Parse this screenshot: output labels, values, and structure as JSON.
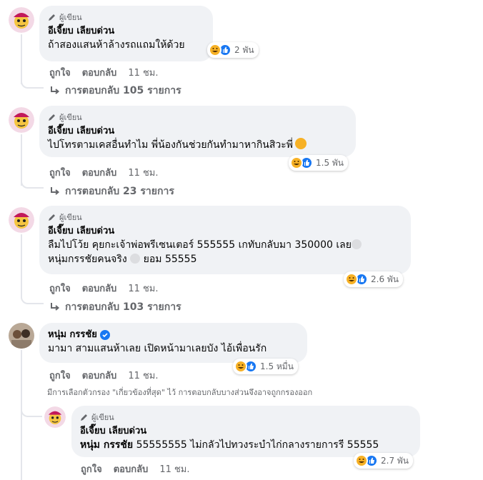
{
  "badge_label": "ผู้เขียน",
  "comments": [
    {
      "name": "อีเจี๊ยบ เลียบด่วน",
      "text": "ถ้าสองแสนห้าล้างรถแถมให้ด้วย",
      "reaction_count": "2 พัน",
      "like_label": "ถูกใจ",
      "reply_label": "ตอบกลับ",
      "time": "11 ชม.",
      "view_replies": "การตอบกลับ 105 รายการ"
    },
    {
      "name": "อีเจี๊ยบ เลียบด่วน",
      "text": "ไปโทรตามเคสอื่นทำไม พี่น้องกันช่วยกันทำมาหากินสิวะพี่",
      "reaction_count": "1.5 พัน",
      "like_label": "ถูกใจ",
      "reply_label": "ตอบกลับ",
      "time": "11 ชม.",
      "view_replies": "การตอบกลับ 23 รายการ"
    },
    {
      "name": "อีเจี๊ยบ เลียบด่วน",
      "text_line1": "ลืมไปโว้ย คุยกะเจ้าพ่อพรีเซนเตอร์ 555555 เกทับกลับมา 350000 เลย",
      "text_line2a": "หนุ่มกรรชัยคนจริง",
      "text_line2b": "ยอม 55555",
      "reaction_count": "2.6 พัน",
      "like_label": "ถูกใจ",
      "reply_label": "ตอบกลับ",
      "time": "11 ชม.",
      "view_replies": "การตอบกลับ 103 รายการ"
    },
    {
      "name": "หนุ่ม กรรชัย",
      "text": "มามา สามแสนห้าเลย เปิดหน้ามาเลยบัง ไอ้เพื่อนรัก",
      "reaction_count": "1.5 หมื่น",
      "like_label": "ถูกใจ",
      "reply_label": "ตอบกลับ",
      "time": "11 ชม.",
      "filter_note": "มีการเลือกตัวกรอง \"เกี่ยวข้องที่สุด\" ไว้ การตอบกลับบางส่วนจึงอาจถูกกรองออก"
    },
    {
      "name": "อีเจี๊ยบ เลียบด่วน",
      "mention": "หนุ่ม กรรชัย",
      "text": "55555555 ไม่กลัวไปทวงระบำไก่กลางรายการรี 55555",
      "reaction_count": "2.7 พัน",
      "like_label": "ถูกใจ",
      "reply_label": "ตอบกลับ",
      "time": "11 ชม."
    }
  ],
  "colors": {
    "bubble": "#f0f2f5",
    "secondary_text": "#65676b",
    "like_blue": "#1877f2",
    "haha_yellow": "#f7b125"
  }
}
